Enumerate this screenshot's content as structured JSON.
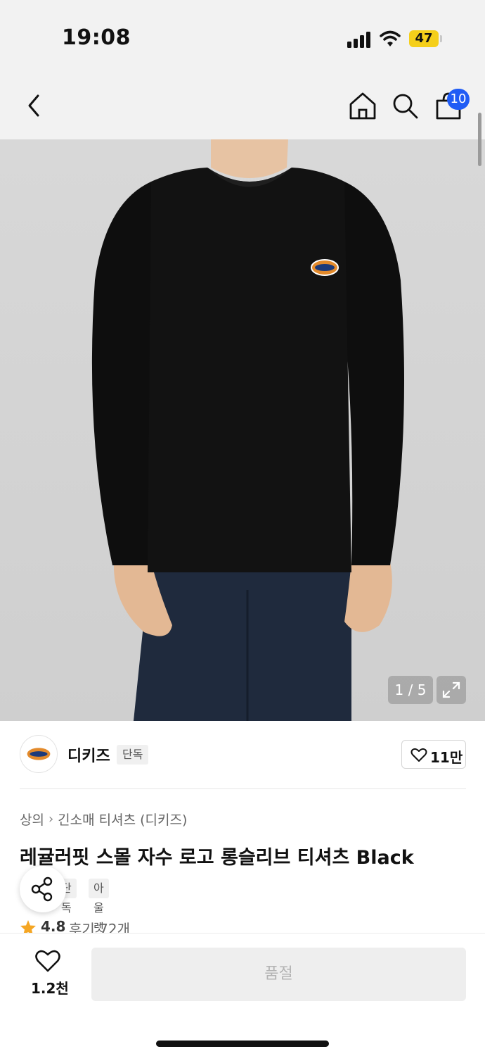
{
  "status_bar": {
    "time": "19:08",
    "battery": "47"
  },
  "nav": {
    "cart_count": "10"
  },
  "image": {
    "counter": "1 / 5"
  },
  "brand": {
    "name": "디키즈",
    "tag": "단독",
    "like_count": "11만"
  },
  "breadcrumb": {
    "category": "상의",
    "subcategory": "긴소매 티셔츠 (디키즈)"
  },
  "product": {
    "title": "레귤러핏 스몰 자수 로고 롱슬리브 티셔츠 Black",
    "tags": [
      "단독",
      "아울렛"
    ],
    "rating": "4.8",
    "reviews": "후기 72개"
  },
  "bottom_bar": {
    "wish_count": "1.2천",
    "buy_label": "품절"
  },
  "colors": {
    "accent": "#1f5cf5",
    "star": "#f5a623",
    "battery": "#f5cf1a"
  }
}
